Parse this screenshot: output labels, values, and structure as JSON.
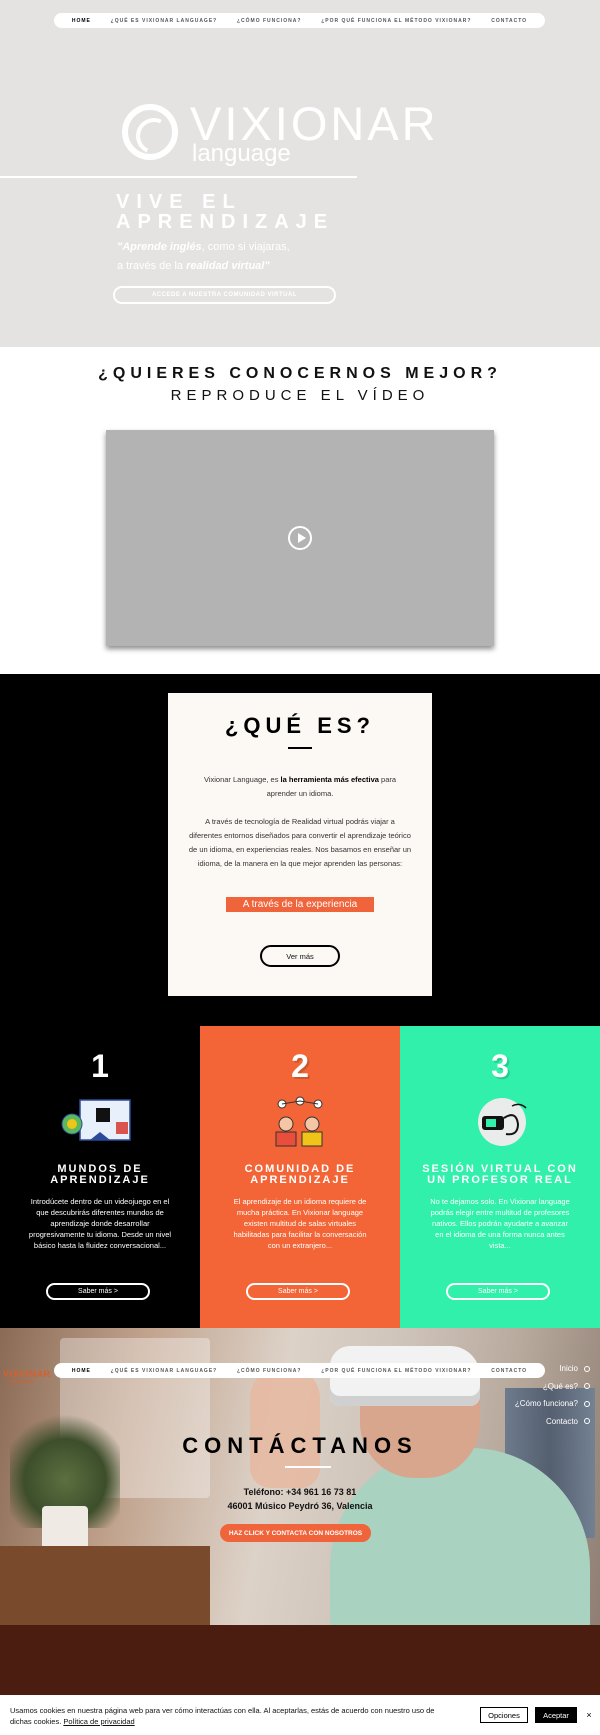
{
  "nav": {
    "items": [
      {
        "label": "HOME",
        "active": true
      },
      {
        "label": "¿QUÉ ES VIXIONAR LANGUAGE?"
      },
      {
        "label": "¿CÓMO FUNCIONA?"
      },
      {
        "label": "¿POR QUÉ FUNCIONA EL MÉTODO VIXIONAR?"
      },
      {
        "label": "CONTACTO"
      }
    ]
  },
  "hero": {
    "logo_word": "VIXIONAR",
    "logo_sub": "language",
    "title_line1": "VIVE EL",
    "title_line2": "APRENDIZAJE",
    "quote_a": "\"Aprende inglés",
    "quote_b": ", como si viajaras,",
    "quote_c": "a través de la ",
    "quote_d": "realidad virtual\"",
    "button_label": "ACCEDE A NUESTRA COMUNIDAD VIRTUAL"
  },
  "video": {
    "heading": "¿QUIERES CONOCERNOS MEJOR?",
    "subheading": "REPRODUCE EL VÍDEO"
  },
  "que_es": {
    "title": "¿QUÉ ES?",
    "p1_a": "Vixionar Language, es ",
    "p1_b": "la herramienta más efectiva",
    "p1_c": " para aprender un idioma.",
    "p2": "A través de tecnología de Realidad virtual podrás viajar a diferentes entornos diseñados para convertir el aprendizaje teórico de un idioma, en experiencias reales. Nos basamos en enseñar un idioma, de la manera en la que mejor aprenden las personas:",
    "highlight": "A través de la experiencia",
    "button_label": "Ver más"
  },
  "columns": [
    {
      "number": "1",
      "title": "MUNDOS DE APRENDIZAJE",
      "text": "Introdúcete dentro de un videojuego en el que descubrirás diferentes mundos de aprendizaje donde desarrollar progresivamente tu idioma. Desde un nivel básico hasta la fluidez conversacional...",
      "button_label": "Saber más >"
    },
    {
      "number": "2",
      "title": "COMUNIDAD DE APRENDIZAJE",
      "text": "El aprendizaje de un idioma requiere de mucha práctica. En Vixionar language existen multitud de salas virtuales habilitadas para facilitar la conversación con un extranjero...",
      "button_label": "Saber más >"
    },
    {
      "number": "3",
      "title": "SESIÓN VIRTUAL CON UN PROFESOR REAL",
      "text": "No te dejamos solo. En Vixionar language podrás elegir entre multitud de profesores nativos. Ellos podrán ayudarte a avanzar en el idioma de una forma nunca antes vista...",
      "button_label": "Saber más >"
    }
  ],
  "contact": {
    "logo_word": "VIXIONAR",
    "logo_sub": "language",
    "side_nav": [
      "Inicio",
      "¿Qué es?",
      "¿Cómo funciona?",
      "Contacto"
    ],
    "title": "CONTÁCTANOS",
    "phone": "Teléfono: +34 961 16 73 81",
    "address": "46001 Músico Peydró 36, Valencia",
    "button_label": "HAZ CLICK Y CONTACTA CON NOSOTROS"
  },
  "cookie": {
    "text": "Usamos cookies en nuestra página web para ver cómo interactúas con ella. Al aceptarlas, estás de acuerdo con nuestro uso de dichas cookies.",
    "link": "Política de privacidad",
    "options_label": "Opciones",
    "accept_label": "Aceptar",
    "close_label": "×"
  },
  "colors": {
    "hero_bg": "#e5e2e2",
    "accent_orange": "#f36536",
    "accent_green": "#30f0ab",
    "footer_brown": "#4a1d10"
  }
}
